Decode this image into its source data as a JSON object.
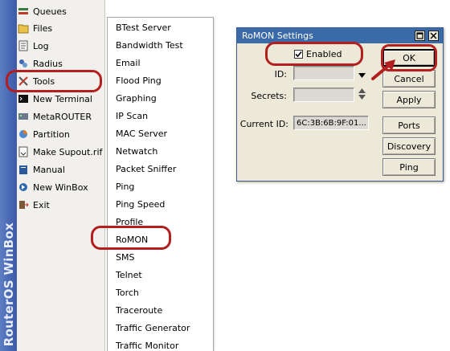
{
  "brand": {
    "text": "RouterOS WinBox"
  },
  "main_menu": {
    "items": [
      {
        "label": "Queues",
        "icon": "queues-icon"
      },
      {
        "label": "Files",
        "icon": "files-icon"
      },
      {
        "label": "Log",
        "icon": "log-icon"
      },
      {
        "label": "Radius",
        "icon": "radius-icon"
      },
      {
        "label": "Tools",
        "icon": "tools-icon"
      },
      {
        "label": "New Terminal",
        "icon": "terminal-icon"
      },
      {
        "label": "MetaROUTER",
        "icon": "metarouter-icon"
      },
      {
        "label": "Partition",
        "icon": "partition-icon"
      },
      {
        "label": "Make Supout.rif",
        "icon": "supout-icon"
      },
      {
        "label": "Manual",
        "icon": "manual-icon"
      },
      {
        "label": "New WinBox",
        "icon": "winbox-icon"
      },
      {
        "label": "Exit",
        "icon": "exit-icon"
      }
    ]
  },
  "tools_submenu": {
    "items": [
      "BTest Server",
      "Bandwidth Test",
      "Email",
      "Flood Ping",
      "Graphing",
      "IP Scan",
      "MAC Server",
      "Netwatch",
      "Packet Sniffer",
      "Ping",
      "Ping Speed",
      "Profile",
      "RoMON",
      "SMS",
      "Telnet",
      "Torch",
      "Traceroute",
      "Traffic Generator",
      "Traffic Monitor"
    ]
  },
  "dialog": {
    "title": "RoMON Settings",
    "enabled_label": "Enabled",
    "enabled_checked": true,
    "id_label": "ID:",
    "id_value": "",
    "secrets_label": "Secrets:",
    "secrets_value": "",
    "current_id_label": "Current ID:",
    "current_id_value": "6C:3B:6B:9F:01...",
    "buttons": {
      "ok": "OK",
      "cancel": "Cancel",
      "apply": "Apply",
      "ports": "Ports",
      "discovery": "Discovery",
      "ping": "Ping"
    }
  },
  "colors": {
    "highlight_ring": "#b31f1f",
    "titlebar": "#3b6aa8",
    "brand_strip": "#4a6ab6"
  }
}
